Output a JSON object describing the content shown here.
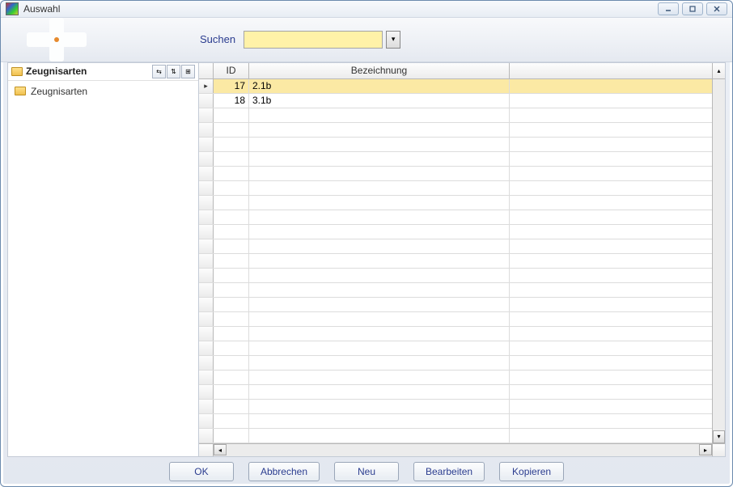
{
  "window": {
    "title": "Auswahl"
  },
  "toolbar": {
    "search_label": "Suchen",
    "search_value": ""
  },
  "tree": {
    "header": "Zeugnisarten",
    "items": [
      {
        "label": "Zeugnisarten"
      }
    ]
  },
  "grid": {
    "columns": {
      "id": "ID",
      "bezeichnung": "Bezeichnung"
    },
    "rows": [
      {
        "id": "17",
        "bez": "2.1b",
        "selected": true
      },
      {
        "id": "18",
        "bez": "3.1b",
        "selected": false
      }
    ],
    "empty_row_count": 23
  },
  "buttons": {
    "ok": "OK",
    "cancel": "Abbrechen",
    "new": "Neu",
    "edit": "Bearbeiten",
    "copy": "Kopieren"
  }
}
